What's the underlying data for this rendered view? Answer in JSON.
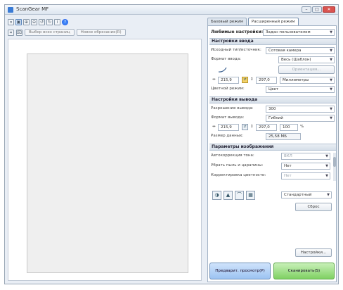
{
  "window": {
    "title": "ScanGear MF",
    "btn_min": "–",
    "btn_max": "□",
    "btn_close": "✕"
  },
  "toolbar": {
    "help_glyph": "?",
    "select_all_label": "Выбор всех страниц",
    "reset_selection_label": "Новое обрезание(R)"
  },
  "tabs": [
    "Базовый режим",
    "Расширенный режим"
  ],
  "preferences": {
    "label": "Любимые настройки:",
    "value": "Задан пользователем"
  },
  "input_settings": {
    "header": "Настройки ввода",
    "select_source_label": "Исходный тип/источник:",
    "select_source_value": "Сотовая камера",
    "paper_size_label": "Формат ввода:",
    "paper_size_value": "Весь (Шаблон)",
    "orientation_button": "Ориентация...",
    "width_value": "215,9",
    "height_value": "297,0",
    "units_value": "Миллиметры",
    "color_mode_label": "Цветной режим:",
    "color_mode_value": "Цвет"
  },
  "output_settings": {
    "header": "Настройки вывода",
    "resolution_label": "Разрешение вывода:",
    "resolution_value": "300",
    "output_size_label": "Формат вывода:",
    "output_size_value": "Гибкий",
    "out_width": "215,9",
    "out_height": "297,0",
    "out_percent": "100",
    "out_pct_unit": "%",
    "data_size_label": "Размер данных:",
    "data_size_value": "25,58 МБ"
  },
  "image_settings": {
    "header": "Параметры изображения",
    "auto_tone_label": "Автокоррекция тона:",
    "auto_tone_value": "ВКЛ",
    "descreen_label": "Убрать пыль и царапины:",
    "descreen_value": "Нет",
    "grain_label": "Корректировка цветности:",
    "grain_value": "Нет"
  },
  "adjust": {
    "preset_value": "Стандартный",
    "reset_button": "Сброс",
    "settings_button": "Настройки..."
  },
  "actions": {
    "preview_button": "Предварит. просмотр(P)",
    "scan_button": "Сканировать(S)"
  }
}
